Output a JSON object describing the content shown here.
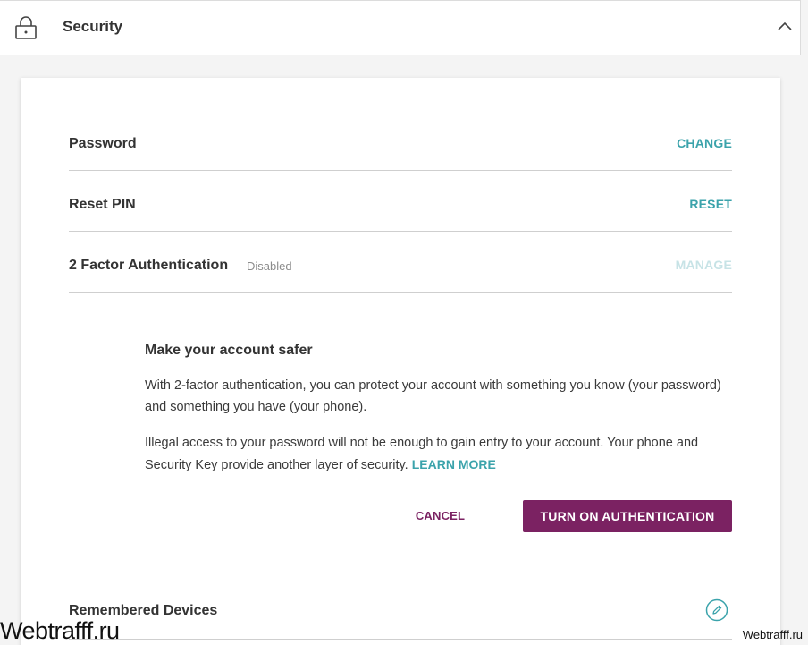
{
  "section": {
    "title": "Security",
    "icon": "lock-icon",
    "toggle_icon": "chevron-up-icon"
  },
  "rows": [
    {
      "label": "Password",
      "action": "CHANGE"
    },
    {
      "label": "Reset PIN",
      "action": "RESET"
    },
    {
      "label": "2 Factor Authentication",
      "status": "Disabled",
      "action": "MANAGE"
    }
  ],
  "promo": {
    "title": "Make your account safer",
    "paragraph1": "With 2-factor authentication, you can protect your account with something you know (your password) and something you have (your phone).",
    "paragraph2": "Illegal access to your password will not be enough to gain entry to your account. Your phone and Security Key provide another layer of security.",
    "learn_more": "LEARN MORE",
    "cancel": "CANCEL",
    "turn_on": "TURN ON AUTHENTICATION"
  },
  "devices": {
    "label": "Remembered Devices",
    "icon": "edit-icon"
  },
  "watermark": {
    "left": "Webtrafff.ru",
    "right": "Webtrafff.ru"
  },
  "colors": {
    "accent": "#3ba3ab",
    "accent_disabled": "#c7e3e6",
    "primary": "#7b2262"
  }
}
